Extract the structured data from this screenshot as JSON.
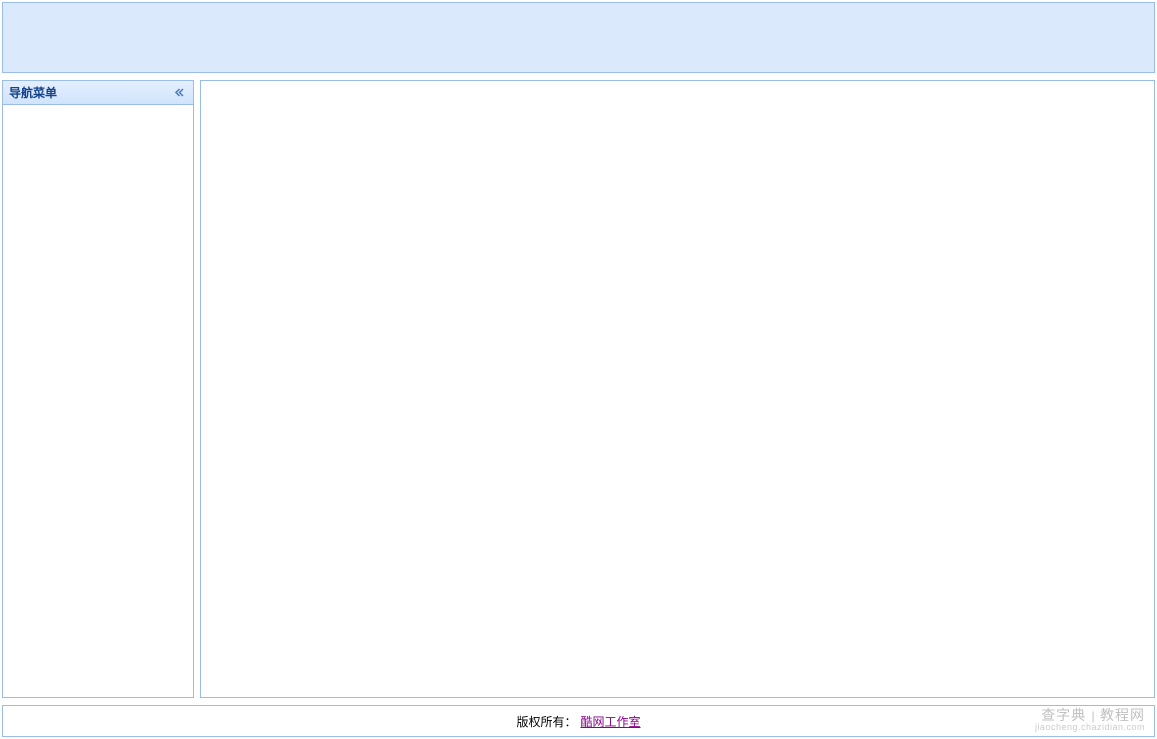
{
  "sidebar": {
    "title": "导航菜单"
  },
  "footer": {
    "copyright_label": "版权所有：",
    "link_text": "酷网工作室"
  },
  "watermark": {
    "line1_left": "查字典",
    "line1_right": "教程网",
    "line2": "jiaocheng.chazidian.com"
  }
}
